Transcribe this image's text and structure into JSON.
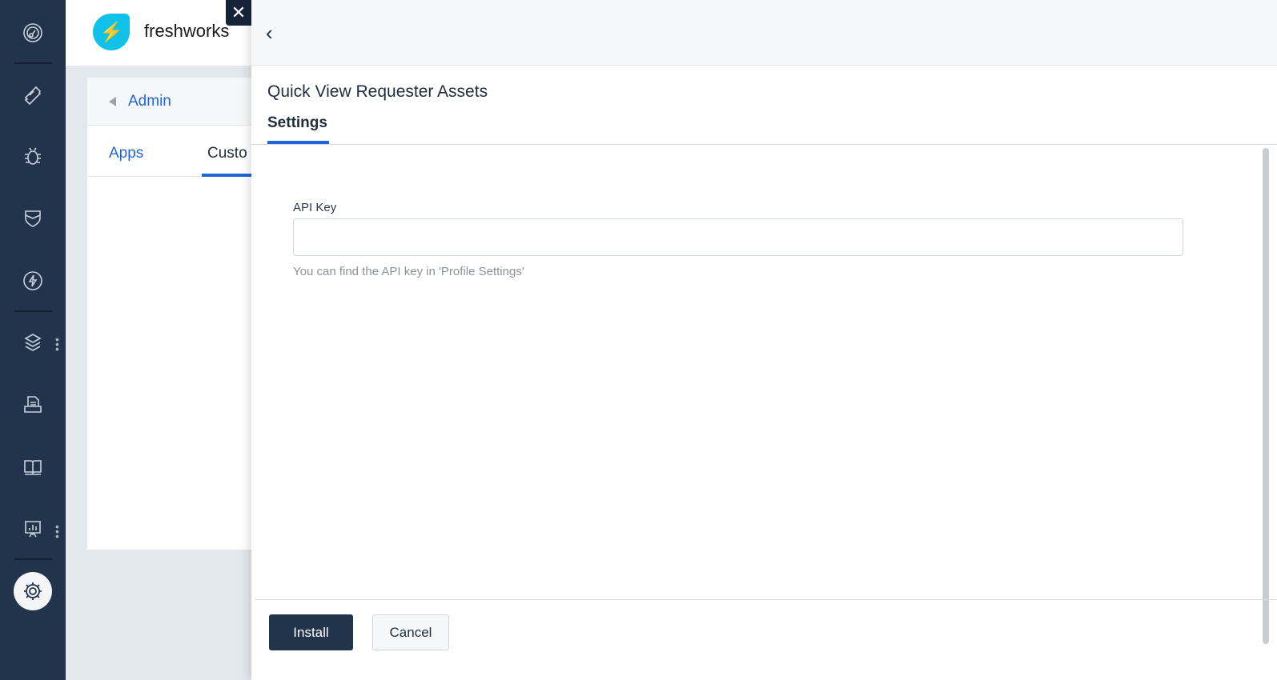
{
  "brand": {
    "name": "freshworks"
  },
  "close_label": "✕",
  "admin_card": {
    "breadcrumb": "Admin",
    "tabs": [
      {
        "label": "Apps"
      },
      {
        "label": "Custo"
      }
    ]
  },
  "panel": {
    "back_label": "‹",
    "title": "Quick View Requester Assets",
    "tab": "Settings",
    "api_key": {
      "label": "API Key",
      "value": "",
      "hint": "You can find the API key in 'Profile Settings'"
    },
    "install_label": "Install",
    "cancel_label": "Cancel"
  },
  "colors": {
    "sidebar": "#21344c",
    "accent": "#2166d8",
    "logo": "#10c2e9"
  }
}
